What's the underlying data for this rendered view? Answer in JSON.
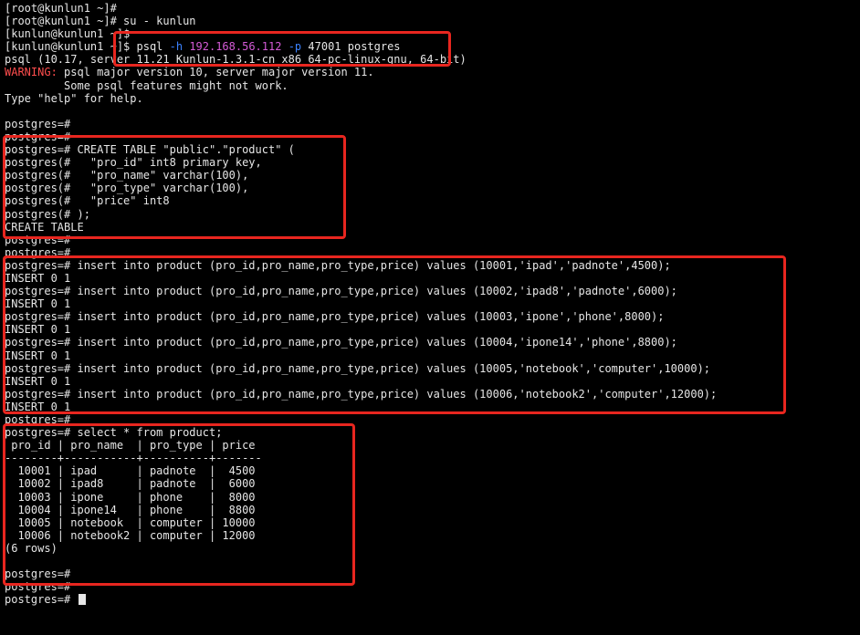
{
  "colors": {
    "background": "#000000",
    "text": "#e6e6e6",
    "warning": "#ff4d4d",
    "host_highlight": "#d45bd6",
    "flag_highlight": "#3b82ff",
    "annotation_box": "#e8261f"
  },
  "terminal": {
    "l0": "[root@kunlun1 ~]#",
    "l1": "[root@kunlun1 ~]# su - kunlun",
    "l2": "[kunlun@kunlun1 ~]$",
    "l3": {
      "prefix": "[kunlun@kunlun1 ~]$ psql ",
      "flag_h": "-h",
      "host": "192.168.56.112",
      "flag_p": "-p",
      "rest": "47001 postgres"
    },
    "l4": "psql (10.17, server 11.21 Kunlun-1.3.1-cn x86_64-pc-linux-gnu, 64-bit)",
    "l5": {
      "label": "WARNING:",
      "text": " psql major version 10, server major version 11."
    },
    "l6": "         Some psql features might not work.",
    "l7": "Type \"help\" for help.",
    "l8": "",
    "l9": "postgres=#",
    "l10": "postgres=#",
    "l11": "postgres=# CREATE TABLE \"public\".\"product\" (",
    "l12": "postgres(#   \"pro_id\" int8 primary key,",
    "l13": "postgres(#   \"pro_name\" varchar(100),",
    "l14": "postgres(#   \"pro_type\" varchar(100),",
    "l15": "postgres(#   \"price\" int8",
    "l16": "postgres(# );",
    "l17": "CREATE TABLE",
    "l18": "postgres=#",
    "l19": "postgres=#",
    "l20": "postgres=# insert into product (pro_id,pro_name,pro_type,price) values (10001,'ipad','padnote',4500);",
    "l21": "INSERT 0 1",
    "l22": "postgres=# insert into product (pro_id,pro_name,pro_type,price) values (10002,'ipad8','padnote',6000);",
    "l23": "INSERT 0 1",
    "l24": "postgres=# insert into product (pro_id,pro_name,pro_type,price) values (10003,'ipone','phone',8000);",
    "l25": "INSERT 0 1",
    "l26": "postgres=# insert into product (pro_id,pro_name,pro_type,price) values (10004,'ipone14','phone',8800);",
    "l27": "INSERT 0 1",
    "l28": "postgres=# insert into product (pro_id,pro_name,pro_type,price) values (10005,'notebook','computer',10000);",
    "l29": "INSERT 0 1",
    "l30": "postgres=# insert into product (pro_id,pro_name,pro_type,price) values (10006,'notebook2','computer',12000);",
    "l31": "INSERT 0 1",
    "l32": "postgres=#",
    "l33": "postgres=# select * from product;",
    "l34": " pro_id | pro_name  | pro_type | price",
    "l35": "--------+-----------+----------+-------",
    "l36": "  10001 | ipad      | padnote  |  4500",
    "l37": "  10002 | ipad8     | padnote  |  6000",
    "l38": "  10003 | ipone     | phone    |  8000",
    "l39": "  10004 | ipone14   | phone    |  8800",
    "l40": "  10005 | notebook  | computer | 10000",
    "l41": "  10006 | notebook2 | computer | 12000",
    "l42": "(6 rows)",
    "l43": "",
    "l44": "postgres=#",
    "l45": "postgres=#",
    "l46": "postgres=# "
  }
}
